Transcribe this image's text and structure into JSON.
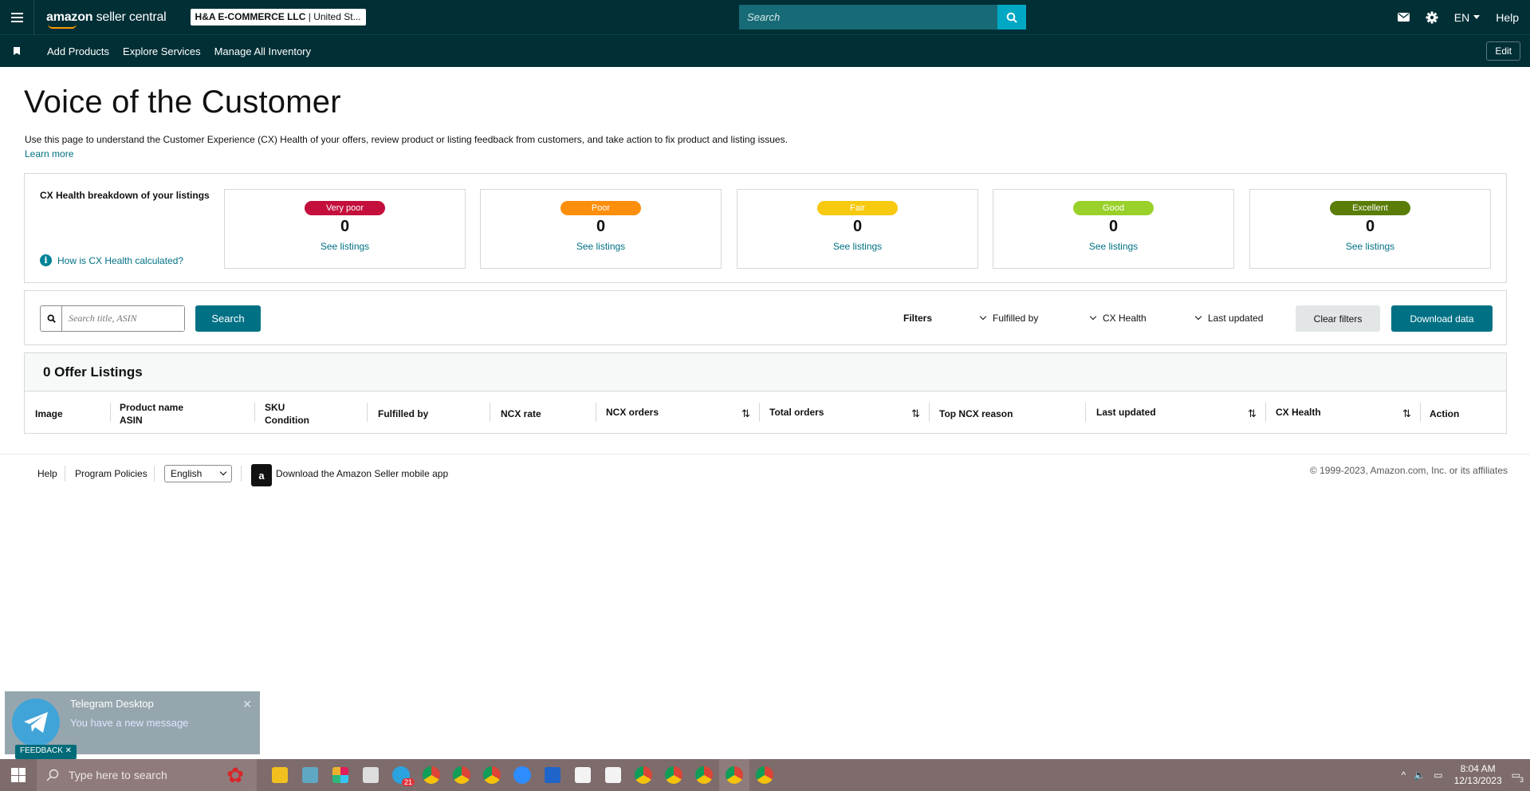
{
  "header": {
    "logo_text": "amazon",
    "logo_text_2": "seller central",
    "account_name": "H&A E-COMMERCE LLC",
    "account_region": "| United St...",
    "search_placeholder": "Search",
    "language": "EN",
    "help": "Help"
  },
  "subnav": {
    "items": [
      "Add Products",
      "Explore Services",
      "Manage All Inventory"
    ],
    "edit": "Edit"
  },
  "page": {
    "title": "Voice of the Customer",
    "description": "Use this page to understand the Customer Experience (CX) Health of your offers, review product or listing feedback from customers, and take action to fix product and listing issues.",
    "learn_more": "Learn more"
  },
  "cx_health": {
    "title": "CX Health breakdown of your listings",
    "how_link": "How is CX Health calculated?",
    "info_glyph": "i",
    "cards": [
      {
        "label": "Very poor",
        "count": "0",
        "link": "See listings",
        "color": "#c40e3c"
      },
      {
        "label": "Poor",
        "count": "0",
        "link": "See listings",
        "color": "#fe8f0c"
      },
      {
        "label": "Fair",
        "count": "0",
        "link": "See listings",
        "color": "#f7c90f"
      },
      {
        "label": "Good",
        "count": "0",
        "link": "See listings",
        "color": "#99d12a"
      },
      {
        "label": "Excellent",
        "count": "0",
        "link": "See listings",
        "color": "#5a7d07"
      }
    ]
  },
  "filters": {
    "search_placeholder": "Search title, ASIN",
    "search_button": "Search",
    "label": "Filters",
    "dropdowns": [
      "Fulfilled by",
      "CX Health",
      "Last updated"
    ],
    "clear": "Clear filters",
    "download": "Download data"
  },
  "table": {
    "title": "0 Offer Listings",
    "columns": {
      "image": "Image",
      "product_name": "Product name",
      "asin": "ASIN",
      "sku": "SKU",
      "condition": "Condition",
      "fulfilled_by": "Fulfilled by",
      "ncx_rate": "NCX rate",
      "ncx_orders": "NCX orders",
      "total_orders": "Total orders",
      "top_reason": "Top NCX reason",
      "last_updated": "Last updated",
      "cx_health": "CX Health",
      "action": "Action"
    }
  },
  "footer": {
    "help": "Help",
    "policies": "Program Policies",
    "language": "English",
    "app_text": "Download the Amazon Seller mobile app",
    "app_icon_glyph": "a",
    "copyright": "© 1999-2023, Amazon.com, Inc. or its affiliates"
  },
  "notification": {
    "app": "Telegram Desktop",
    "message": "You have a new message",
    "feedback": "FEEDBACK ✕"
  },
  "taskbar": {
    "search_placeholder": "Type here to search",
    "time": "8:04 AM",
    "date": "12/13/2023",
    "badge": "21",
    "notif_count": "3"
  }
}
